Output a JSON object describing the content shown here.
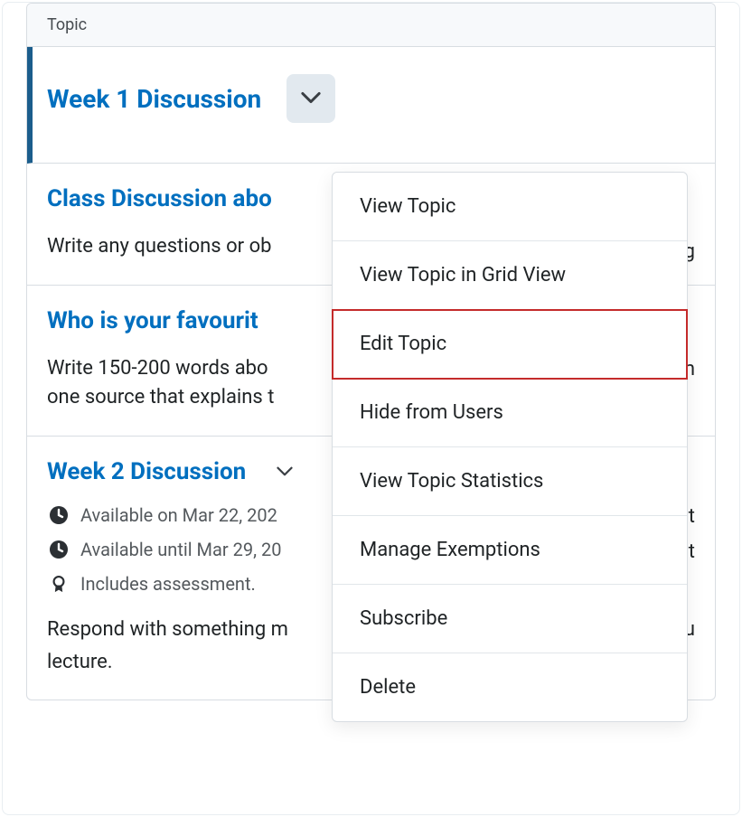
{
  "table_header": "Topic",
  "topics": [
    {
      "title": "Week 1 Discussion",
      "active": true
    },
    {
      "title": "Class Discussion abo",
      "desc": "Write any questions or ob",
      "right1": "nding"
    },
    {
      "title": "Who is your favourit",
      "desc": "Write 150-200 words abo",
      "desc2": "one source that explains t",
      "right1": "ronom"
    },
    {
      "title": "Week 2 Discussion",
      "meta": {
        "avail_on": "Available on Mar 22, 202",
        "avail_until": "Available until Mar 29, 20",
        "assessment": "Includes assessment."
      },
      "right1": "labilit",
      "right2": "labilit",
      "desc": "Respond with something m",
      "desc_tail": "you",
      "desc2": "lecture."
    }
  ],
  "menu": {
    "view_topic": "View Topic",
    "grid_view": "View Topic in Grid View",
    "edit_topic": "Edit Topic",
    "hide": "Hide from Users",
    "stats": "View Topic Statistics",
    "exemptions": "Manage Exemptions",
    "subscribe": "Subscribe",
    "delete": "Delete"
  }
}
